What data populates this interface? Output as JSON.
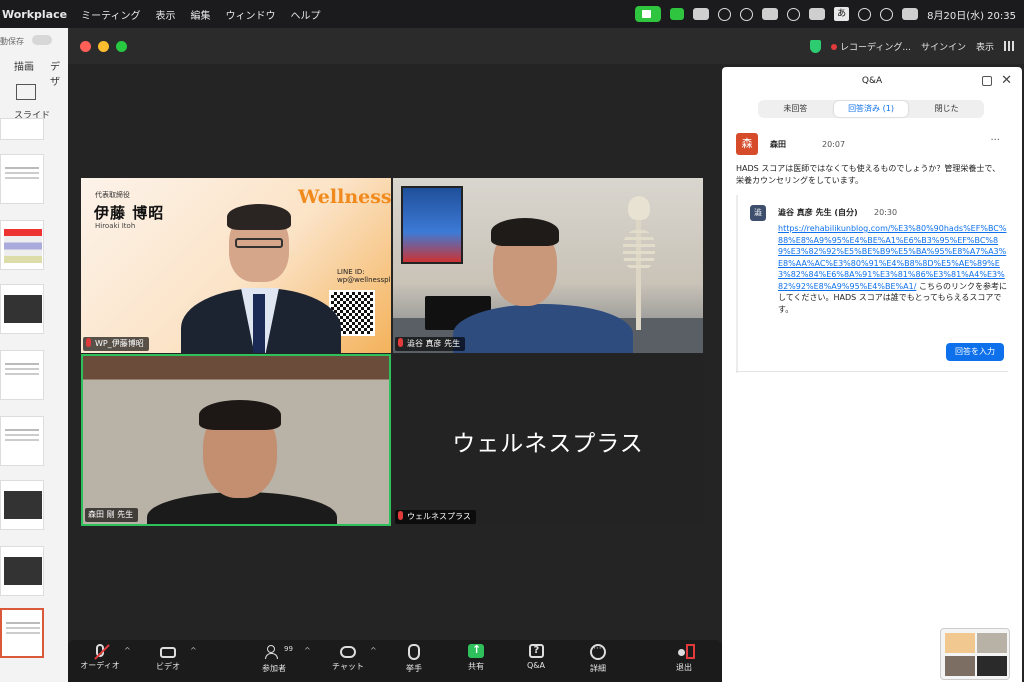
{
  "menubar": {
    "app_name": "Workplace",
    "menus": [
      "ミーティング",
      "表示",
      "編集",
      "ウィンドウ",
      "ヘルプ"
    ],
    "datetime": "8月20日(水) 20:35",
    "input_mode": "あ"
  },
  "background_app": {
    "autosave_label": "動保存",
    "tab_draw": "描画",
    "tab_design": "デザ",
    "slide_label": "スライド"
  },
  "titlebar": {
    "recording_label": "レコーディング...",
    "signin_label": "サインイン",
    "view_label": "表示"
  },
  "videos": {
    "tile1": {
      "name": "WP_伊藤博昭",
      "role": "代表取締役",
      "person_name": "伊藤 博昭",
      "person_romaji": "Hiroaki Itoh",
      "brand": "Wellness+",
      "line_id": "LINE ID: wp@wellnessplus"
    },
    "tile2": {
      "name": "澁谷 真彦 先生"
    },
    "tile3": {
      "name": "森田 剛 先生"
    },
    "tile4": {
      "name": "ウェルネスプラス",
      "display_name": "ウェルネスプラス"
    }
  },
  "toolbar": {
    "audio": "オーディオ",
    "video": "ビデオ",
    "participants": "参加者",
    "participants_count": "99",
    "chat": "チャット",
    "raise_hand": "挙手",
    "share": "共有",
    "qa": "Q&A",
    "more": "詳細",
    "leave": "退出"
  },
  "qa_panel": {
    "title": "Q&A",
    "tabs": [
      "未回答",
      "回答済み (1)",
      "閉じた"
    ],
    "active_tab": 1,
    "question": {
      "avatar_char": "森",
      "author": "森田",
      "time": "20:07",
      "text": "HADS スコアは医師ではなくても使えるものでしょうか？管理栄養士で、栄養カウンセリングをしています。"
    },
    "answer": {
      "avatar_char": "澁",
      "author": "澁谷 真彦 先生 (自分)",
      "time": "20:30",
      "link": "https://rehabilikunblog.com/%E3%80%90hads%EF%BC%88%E8%A9%95%E4%BE%A1%E6%B3%95%EF%BC%89%E3%82%92%E5%BE%B9%E5%BA%95%E8%A7%A3%E8%AA%AC%E3%80%91%E4%B8%8D%E5%AE%89%E3%82%84%E6%8A%91%E3%81%86%E3%81%A4%E3%82%92%E8%A9%95%E4%BE%A1/",
      "text": " こちらのリンクを参考にしてください。HADS スコアは誰でもとってもらえるスコアです。"
    },
    "reply_button": "回答を入力"
  },
  "colors": {
    "accent_blue": "#0e71eb",
    "share_green": "#2ec05b",
    "mute_red": "#e23b3b",
    "avatar_orange": "#d64b2a"
  }
}
